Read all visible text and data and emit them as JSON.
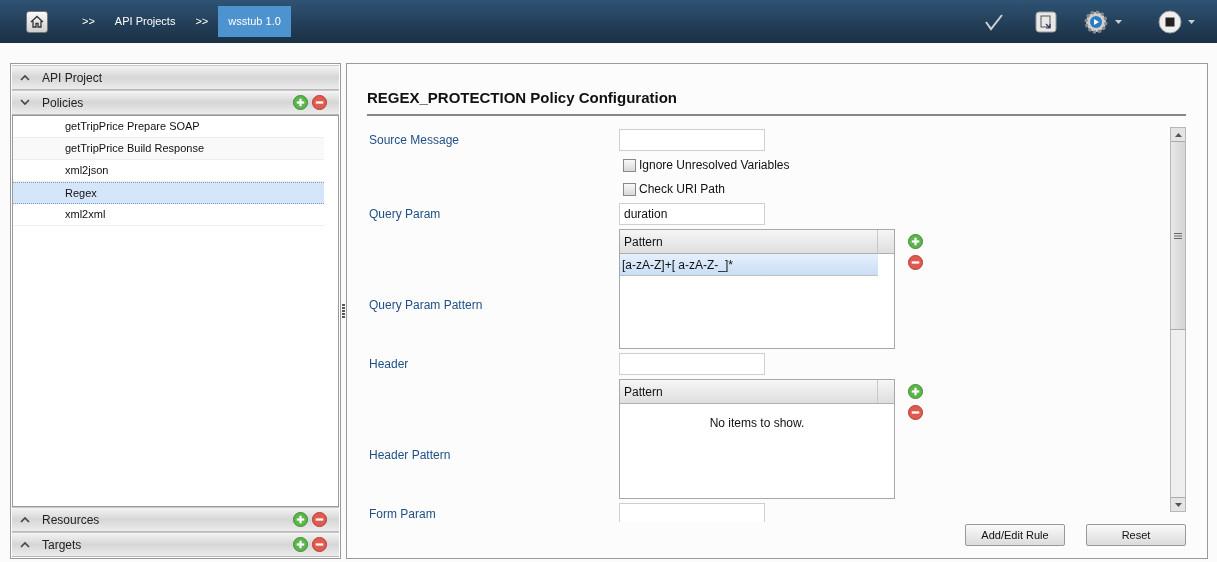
{
  "breadcrumbs": [
    {
      "label": ">>",
      "selected": false
    },
    {
      "label": "API Projects",
      "selected": false
    },
    {
      "label": ">>",
      "selected": false
    },
    {
      "label": "wsstub 1.0",
      "selected": true
    }
  ],
  "sidebar": {
    "sections": [
      {
        "title": "API Project",
        "expanded": false,
        "actions": false
      },
      {
        "title": "Policies",
        "expanded": true,
        "actions": true,
        "items": [
          {
            "label": "getTripPrice Prepare SOAP",
            "selected": false
          },
          {
            "label": "getTripPrice Build Response",
            "selected": false
          },
          {
            "label": "xml2json",
            "selected": false
          },
          {
            "label": "Regex",
            "selected": true
          },
          {
            "label": "xml2xml",
            "selected": false
          }
        ]
      },
      {
        "title": "Resources",
        "expanded": false,
        "actions": true
      },
      {
        "title": "Targets",
        "expanded": false,
        "actions": true
      }
    ]
  },
  "panel": {
    "title": "REGEX_PROTECTION Policy Configuration",
    "fields": [
      {
        "kind": "text",
        "label": "Source Message"
      },
      {
        "kind": "checkbox",
        "label": "Ignore Unresolved Variables",
        "checked": false
      },
      {
        "kind": "checkbox",
        "label": "Check URI Path",
        "checked": false
      },
      {
        "kind": "text",
        "label": "Query Param",
        "value": "duration"
      },
      {
        "kind": "table",
        "label": "Query Param Pattern",
        "column": "Pattern",
        "rows": [
          {
            "text": "[a-zA-Z]+[ a-zA-Z-_]*",
            "selected": true
          }
        ]
      },
      {
        "kind": "text",
        "label": "Header"
      },
      {
        "kind": "table",
        "label": "Header Pattern",
        "column": "Pattern",
        "empty_text": "No items to show."
      },
      {
        "kind": "text",
        "label": "Form Param"
      }
    ],
    "buttons": [
      "Add/Edit Rule",
      "Reset"
    ]
  }
}
